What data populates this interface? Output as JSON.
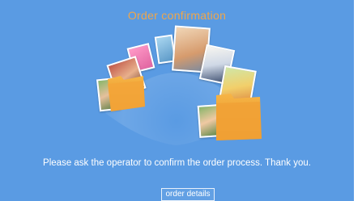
{
  "screen": {
    "title": "Order confirmation",
    "message": "Please ask the operator to confirm the order process. Thank you.",
    "details_button": "order details"
  },
  "colors": {
    "background": "#5a9be3",
    "title": "#f0a64a",
    "folder": "#f0a030",
    "text": "#ffffff"
  },
  "icons": [
    "photo-thumbnail-icon",
    "folder-icon"
  ]
}
